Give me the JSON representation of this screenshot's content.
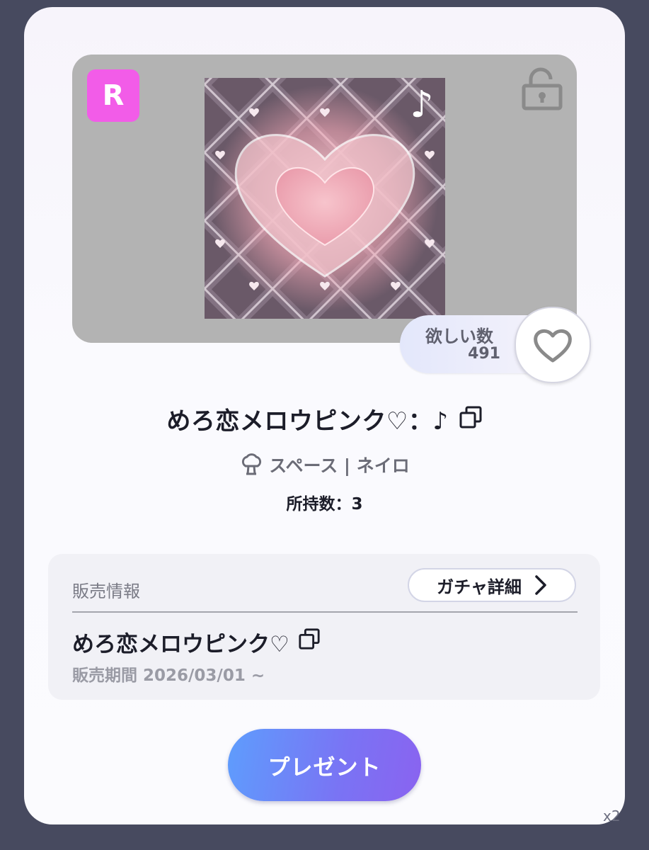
{
  "item": {
    "rarity": "R",
    "title": "めろ恋メロウピンク♡：♪",
    "note_glyph": "♪",
    "category": "スペース | ネイロ",
    "owned": "所持数：3",
    "lock_icon": "unlock-icon"
  },
  "wish": {
    "label": "欲しい数",
    "count": "491"
  },
  "sale": {
    "heading": "販売情報",
    "detail_button": "ガチャ詳細",
    "name": "めろ恋メロウピンク♡",
    "period": "販売期間 2026/03/01 ~"
  },
  "actions": {
    "present": "プレゼント"
  },
  "corner": "x2",
  "colors": {
    "rarity_badge": "#f25ce8",
    "present_start": "#5e9dfd",
    "present_end": "#8a63f0",
    "background": "#474a5f"
  }
}
